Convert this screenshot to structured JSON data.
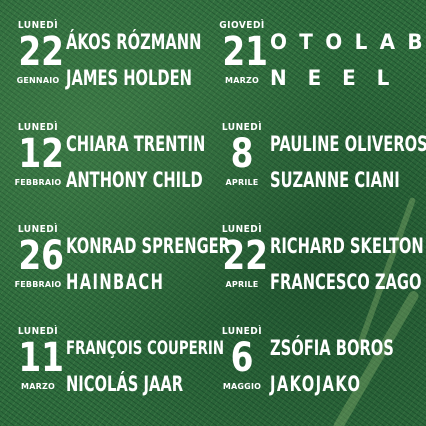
{
  "colors": {
    "background": "#2d6b3c",
    "text": "#ffffff"
  },
  "events": [
    {
      "weekday": "LUNEDÌ",
      "day": "22",
      "month": "GENNAIO",
      "artists": [
        "ÁKOS RÓZMANN",
        "JAMES HOLDEN"
      ]
    },
    {
      "weekday": "GIOVEDÌ",
      "day": "21",
      "month": "MARZO",
      "artists": [
        "OTOLAB",
        "NEEL"
      ]
    },
    {
      "weekday": "LUNEDÌ",
      "day": "12",
      "month": "FEBBRAIO",
      "artists": [
        "CHIARA TRENTIN",
        "ANTHONY CHILD"
      ]
    },
    {
      "weekday": "LUNEDÌ",
      "day": "8",
      "month": "APRILE",
      "artists": [
        "PAULINE OLIVEROS",
        "SUZANNE CIANI"
      ]
    },
    {
      "weekday": "LUNEDÌ",
      "day": "26",
      "month": "FEBBRAIO",
      "artists": [
        "KONRAD SPRENGER",
        "HAINBACH"
      ]
    },
    {
      "weekday": "LUNEDÌ",
      "day": "22",
      "month": "APRILE",
      "artists": [
        "RICHARD SKELTON",
        "FRANCESCO ZAGO"
      ]
    },
    {
      "weekday": "LUNEDÌ",
      "day": "11",
      "month": "MARZO",
      "artists": [
        "FRANÇOIS COUPERIN",
        "NICOLÁS JAAR"
      ]
    },
    {
      "weekday": "LUNEDÌ",
      "day": "6",
      "month": "MAGGIO",
      "artists": [
        "ZSÓFIA BOROS",
        "JAKOJAKO"
      ]
    }
  ]
}
